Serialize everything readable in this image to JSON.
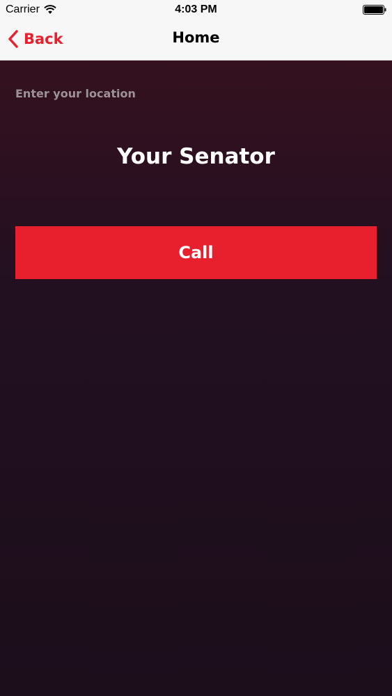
{
  "status_bar": {
    "carrier": "Carrier",
    "time": "4:03 PM",
    "wifi_icon": "wifi-icon",
    "battery_icon": "battery-icon"
  },
  "nav": {
    "back_label": "Back",
    "back_icon": "chevron-left-icon",
    "title": "Home"
  },
  "main": {
    "location_placeholder": "Enter your location",
    "location_value": "",
    "heading": "Your Senator",
    "call_label": "Call"
  },
  "colors": {
    "accent": "#e8202e",
    "background_top": "#35111f",
    "background_bottom": "#1c0e1b",
    "nav_background": "#f7f7f7"
  }
}
